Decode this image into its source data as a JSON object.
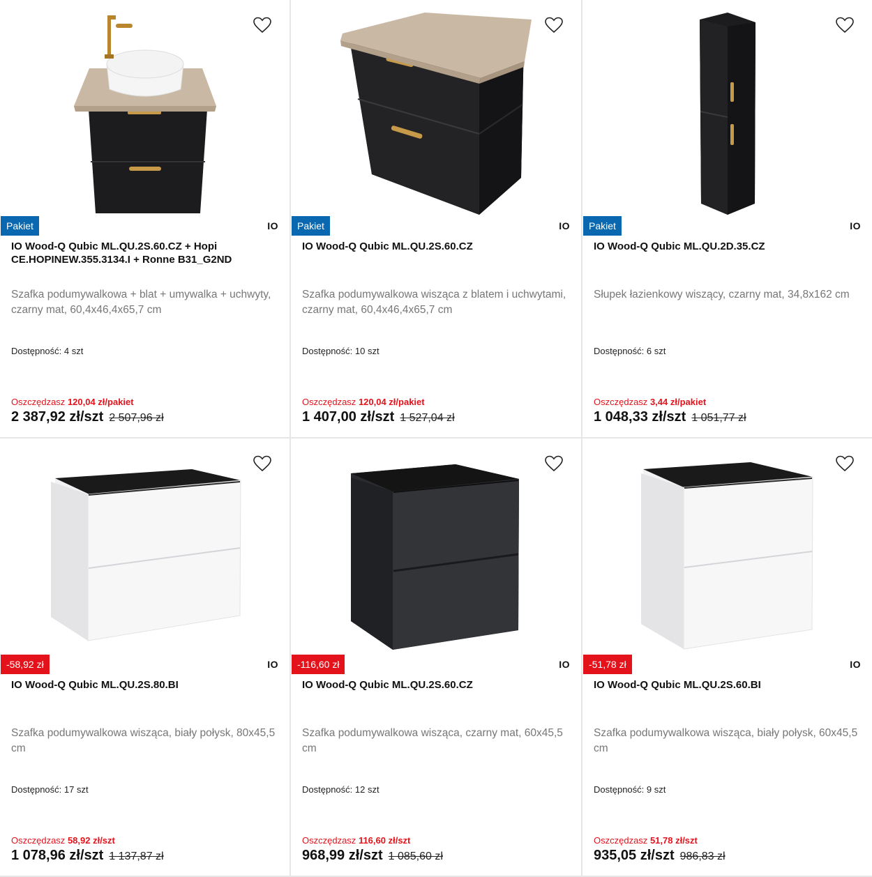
{
  "products": [
    {
      "badge": "Pakiet",
      "badge_type": "pakiet",
      "brand": "IO",
      "title": "IO Wood-Q Qubic ML.QU.2S.60.CZ + Hopi CE.HOPINEW.355.3134.I + Ronne B31_G2ND",
      "description": "Szafka podumywalkowa + blat + umywalka + uchwyty, czarny mat, 60,4x46,4x65,7 cm",
      "availability_label": "Dostępność:",
      "availability_value": "4 szt",
      "save_label": "Oszczędzasz",
      "save_value": "120,04 zł/pakiet",
      "price": "2 387,92 zł/szt",
      "old_price": "2 507,96 zł",
      "image": "black-vanity-with-sink-icon"
    },
    {
      "badge": "Pakiet",
      "badge_type": "pakiet",
      "brand": "IO",
      "title": "IO Wood-Q Qubic ML.QU.2S.60.CZ",
      "description": "Szafka podumywalkowa wisząca z blatem i uchwytami, czarny mat, 60,4x46,4x65,7 cm",
      "availability_label": "Dostępność:",
      "availability_value": "10 szt",
      "save_label": "Oszczędzasz",
      "save_value": "120,04 zł/pakiet",
      "price": "1 407,00 zł/szt",
      "old_price": "1 527,04 zł",
      "image": "black-cabinet-with-top-icon"
    },
    {
      "badge": "Pakiet",
      "badge_type": "pakiet",
      "brand": "IO",
      "title": "IO Wood-Q Qubic ML.QU.2D.35.CZ",
      "description": "Słupek łazienkowy wiszący, czarny mat, 34,8x162 cm",
      "availability_label": "Dostępność:",
      "availability_value": "6 szt",
      "save_label": "Oszczędzasz",
      "save_value": "3,44 zł/pakiet",
      "price": "1 048,33 zł/szt",
      "old_price": "1 051,77 zł",
      "image": "tall-black-column-icon"
    },
    {
      "badge": "-58,92 zł",
      "badge_type": "disc",
      "brand": "IO",
      "title": "IO Wood-Q Qubic ML.QU.2S.80.BI",
      "description": "Szafka podumywalkowa wisząca, biały połysk, 80x45,5 cm",
      "availability_label": "Dostępność:",
      "availability_value": "17 szt",
      "save_label": "Oszczędzasz",
      "save_value": "58,92 zł/szt",
      "price": "1 078,96 zł/szt",
      "old_price": "1 137,87 zł",
      "image": "white-wide-cabinet-icon"
    },
    {
      "badge": "-116,60 zł",
      "badge_type": "disc",
      "brand": "IO",
      "title": "IO Wood-Q Qubic ML.QU.2S.60.CZ",
      "description": "Szafka podumywalkowa wisząca, czarny mat, 60x45,5 cm",
      "availability_label": "Dostępność:",
      "availability_value": "12 szt",
      "save_label": "Oszczędzasz",
      "save_value": "116,60 zł/szt",
      "price": "968,99 zł/szt",
      "old_price": "1 085,60 zł",
      "image": "black-cabinet-icon"
    },
    {
      "badge": "-51,78 zł",
      "badge_type": "disc",
      "brand": "IO",
      "title": "IO Wood-Q Qubic ML.QU.2S.60.BI",
      "description": "Szafka podumywalkowa wisząca, biały połysk, 60x45,5 cm",
      "availability_label": "Dostępność:",
      "availability_value": "9 szt",
      "save_label": "Oszczędzasz",
      "save_value": "51,78 zł/szt",
      "price": "935,05 zł/szt",
      "old_price": "986,83 zł",
      "image": "white-cabinet-icon"
    }
  ],
  "colors": {
    "pakiet_badge": "#0a68b0",
    "discount_badge": "#e4121b",
    "save_text": "#e4121b"
  },
  "icons": {
    "favorite": "heart-outline-icon"
  }
}
